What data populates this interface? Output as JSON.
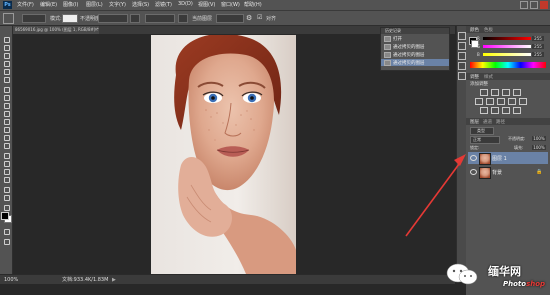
{
  "app": {
    "logo": "Ps",
    "menu": [
      "文件(F)",
      "编辑(E)",
      "图像(I)",
      "图层(L)",
      "文字(Y)",
      "选择(S)",
      "滤镜(T)",
      "3D(D)",
      "视图(V)",
      "窗口(W)",
      "帮助(H)"
    ]
  },
  "options": {
    "mode_label": "模式:",
    "mode_value": "正常",
    "opacity_label": "不透明度:",
    "flow_label": "流量:",
    "pressure_label": "100%",
    "extra_label": "对齐",
    "sample_label": "当前图层"
  },
  "document": {
    "tab_title": "86569016.jpg @ 100% (图层 1, RGB/8#) *",
    "status_zoom": "100%",
    "status_doc": "文档:933.4K/1.83M"
  },
  "history": {
    "title": "历史记录",
    "items": [
      "打开",
      "通过拷贝的图层",
      "通过拷贝的图层",
      "通过拷贝的图层"
    ]
  },
  "color_panel": {
    "tabs": [
      "颜色",
      "色板"
    ],
    "channels": [
      {
        "label": "R",
        "value": "255"
      },
      {
        "label": "G",
        "value": "255"
      },
      {
        "label": "B",
        "value": "255"
      }
    ]
  },
  "adjustments": {
    "tabs": [
      "调整",
      "样式"
    ],
    "title": "添加调整"
  },
  "layers": {
    "tabs": [
      "图层",
      "通道",
      "路径"
    ],
    "kind_label": "类型",
    "mode": "正常",
    "opacity_label": "不透明度:",
    "opacity": "100%",
    "lock_label": "锁定:",
    "fill_label": "填充:",
    "fill": "100%",
    "items": [
      {
        "name": "图层 1",
        "selected": true
      },
      {
        "name": "背景",
        "selected": false
      }
    ]
  },
  "watermark": {
    "brand_text": "缅华网",
    "sub_text_white": "Photo",
    "sub_text_red": "shop"
  },
  "colors": {
    "accent": "#e53935",
    "selection": "#6a82a6",
    "panel": "#535353"
  }
}
